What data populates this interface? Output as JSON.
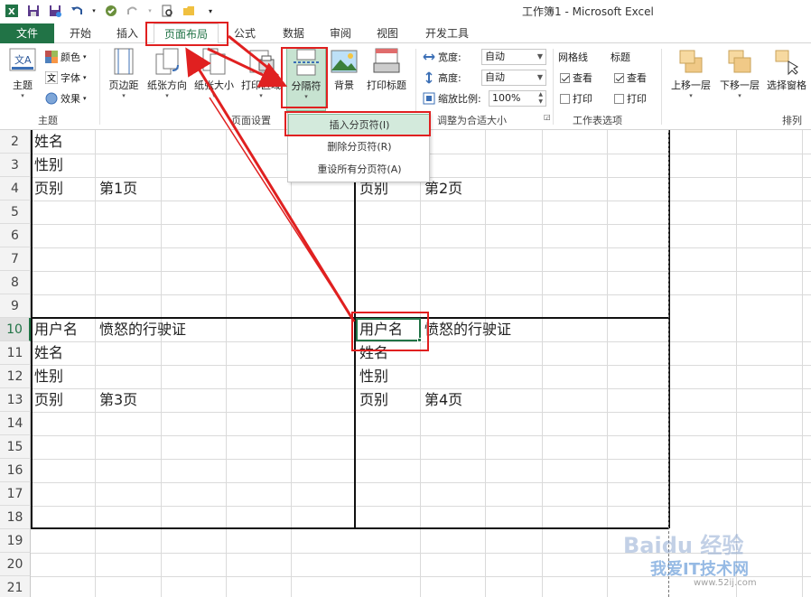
{
  "window": {
    "title": "工作簿1 - Microsoft Excel"
  },
  "tabs": [
    "文件",
    "开始",
    "插入",
    "页面布局",
    "公式",
    "数据",
    "审阅",
    "视图",
    "开发工具"
  ],
  "ribbon": {
    "themes": {
      "label": "主题",
      "colors": "颜色",
      "fonts": "字体",
      "effects": "效果",
      "group": "主题"
    },
    "page_setup": {
      "margins": "页边距",
      "orientation": "纸张方向",
      "size": "纸张大小",
      "print_area": "打印区域",
      "breaks": "分隔符",
      "background": "背景",
      "print_titles": "打印标题",
      "group": "页面设置"
    },
    "scale": {
      "width_label": "宽度:",
      "width_value": "自动",
      "height_label": "高度:",
      "height_value": "自动",
      "zoom_label": "缩放比例:",
      "zoom_value": "100%",
      "group": "调整为合适大小"
    },
    "sheet_options": {
      "gridlines": "网格线",
      "headings": "标题",
      "view": "查看",
      "print": "打印",
      "group": "工作表选项"
    },
    "arrange": {
      "bring_forward": "上移一层",
      "send_backward": "下移一层",
      "selection_pane": "选择窗格",
      "group": "排列"
    }
  },
  "breaks_menu": [
    "插入分页符(I)",
    "删除分页符(R)",
    "重设所有分页符(A)"
  ],
  "row_numbers": [
    "2",
    "3",
    "4",
    "5",
    "6",
    "7",
    "8",
    "9",
    "10",
    "11",
    "12",
    "13",
    "14",
    "15",
    "16",
    "17",
    "18",
    "19",
    "20",
    "21"
  ],
  "cells": {
    "a2": "姓名",
    "a3": "性别",
    "a4": "页别",
    "b4": "第1页",
    "e4": "页别",
    "f4": "第2页",
    "a10": "用户名",
    "b10": "愤怒的行驶证",
    "e10": "用户名",
    "f10": "愤怒的行驶证",
    "a11": "姓名",
    "e11": "姓名",
    "a12": "性别",
    "e12": "性别",
    "a13": "页别",
    "b13": "第3页",
    "e13": "页别",
    "f13": "第4页"
  },
  "watermark": {
    "line1": "Baidu 经验",
    "line2": "我爱IT技术网",
    "line3": "www.52ij.com"
  },
  "colors": {
    "excel_green": "#217346",
    "annotation_red": "#e02020"
  }
}
